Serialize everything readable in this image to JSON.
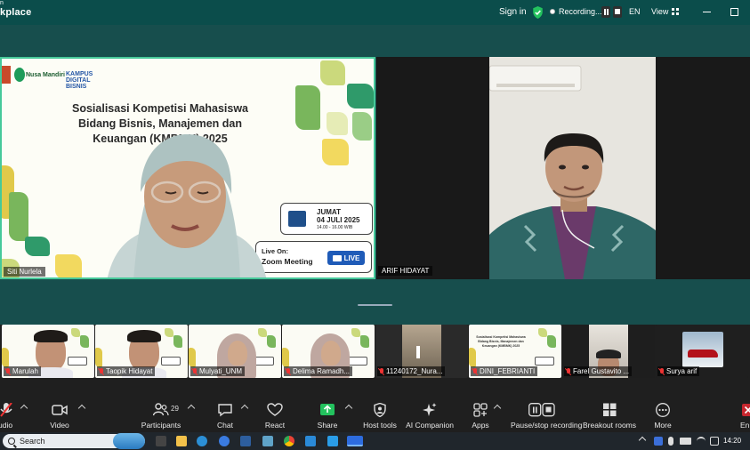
{
  "app": {
    "title": "kplace",
    "title_prefix": "n"
  },
  "topbar": {
    "sign_in": "Sign in",
    "recording": "Recording...",
    "language": "EN",
    "view": "View"
  },
  "presentation": {
    "logo_text": "Nusa Mandiri",
    "logo2_text": "KAMPUS DIGITAL BISNIS",
    "title_lines": [
      "Sosialisasi Kompetisi Mahasiswa",
      "Bidang Bisnis, Manajemen dan",
      "Keuangan (KMBMK) 2025"
    ],
    "date_day": "JUMAT",
    "date_date": "04 JULI 2025",
    "date_time": "14.00 - 16.00 WIB",
    "live_on": "Live On:",
    "zoom_meeting": "Zoom Meeting",
    "live_badge": "LIVE",
    "presenter_name": "Siti Nurlela"
  },
  "speaker": {
    "name": "ARIF HIDAYAT"
  },
  "gallery": [
    {
      "name": "Marulah",
      "muted": true,
      "kind": "slide-man"
    },
    {
      "name": "Taopik Hidayat",
      "muted": true,
      "kind": "slide-man"
    },
    {
      "name": "Mulyati_UNM",
      "muted": true,
      "kind": "slide-hijab"
    },
    {
      "name": "Delima Ramadh...",
      "muted": true,
      "kind": "slide-hijab"
    },
    {
      "name": "11240172_Nura...",
      "muted": true,
      "kind": "room"
    },
    {
      "name": "DINI_FEBRIANTI",
      "muted": true,
      "kind": "slide"
    },
    {
      "name": "Farel Gustavito ...",
      "muted": true,
      "kind": "room2"
    },
    {
      "name": "Surya arif",
      "muted": true,
      "kind": "car"
    }
  ],
  "toolbar": {
    "audio": "udio",
    "video": "Video",
    "participants": "Participants",
    "participants_count": "29",
    "chat": "Chat",
    "react": "React",
    "share": "Share",
    "host_tools": "Host tools",
    "ai_companion": "AI Companion",
    "apps": "Apps",
    "pause_stop_recording": "Pause/stop recording",
    "breakout_rooms": "Breakout rooms",
    "more": "More",
    "end": "En"
  },
  "taskbar": {
    "search": "Search",
    "time": "14:20"
  },
  "colors": {
    "topbar": "#0b4d4b",
    "stage": "#174e4d",
    "accent_green": "#46c99a",
    "toolbar": "#1f1f1f",
    "share_green": "#23c25e"
  }
}
